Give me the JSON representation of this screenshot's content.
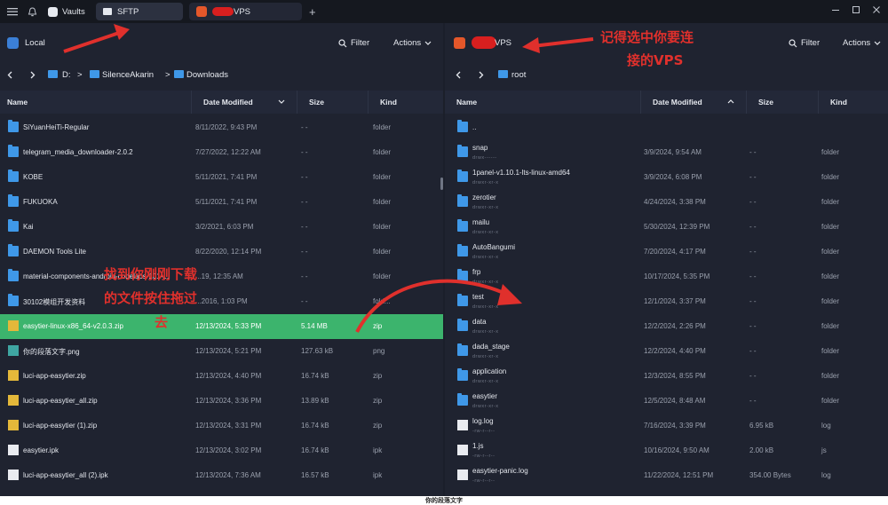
{
  "titlebar": {
    "vaults": "Vaults",
    "sftp_tab": "SFTP",
    "vps_tab": "VPS",
    "add": "+"
  },
  "left": {
    "title": "Local",
    "filter": "Filter",
    "actions": "Actions",
    "crumbs": [
      "D:",
      "SilenceAkarin",
      "Downloads"
    ],
    "cols": {
      "name": "Name",
      "date": "Date Modified",
      "size": "Size",
      "kind": "Kind"
    },
    "rows": [
      {
        "name": "SiYuanHeiTi-Regular",
        "date": "8/11/2022, 9:43 PM",
        "size": "- -",
        "kind": "folder",
        "icon": "folder"
      },
      {
        "name": "telegram_media_downloader-2.0.2",
        "date": "7/27/2022, 12:22 AM",
        "size": "- -",
        "kind": "folder",
        "icon": "folder"
      },
      {
        "name": "KOBE",
        "date": "5/11/2021, 7:41 PM",
        "size": "- -",
        "kind": "folder",
        "icon": "folder"
      },
      {
        "name": "FUKUOKA",
        "date": "5/11/2021, 7:41 PM",
        "size": "- -",
        "kind": "folder",
        "icon": "folder"
      },
      {
        "name": "Kai",
        "date": "3/2/2021, 6:03 PM",
        "size": "- -",
        "kind": "folder",
        "icon": "folder"
      },
      {
        "name": "DAEMON Tools Lite",
        "date": "8/22/2020, 12:14 PM",
        "size": "- -",
        "kind": "folder",
        "icon": "folder"
      },
      {
        "name": "material-components-android-codelabs-101-...",
        "date": "...19, 12:35 AM",
        "size": "- -",
        "kind": "folder",
        "icon": "folder"
      },
      {
        "name": "30102模组开发资料",
        "date": "...2016, 1:03 PM",
        "size": "- -",
        "kind": "fold...",
        "icon": "folder"
      },
      {
        "name": "easytier-linux-x86_64-v2.0.3.zip",
        "date": "12/13/2024, 5:33 PM",
        "size": "5.14 MB",
        "kind": "zip",
        "icon": "zip",
        "selected": true
      },
      {
        "name": "你的段落文字.png",
        "date": "12/13/2024, 5:21 PM",
        "size": "127.63 kB",
        "kind": "png",
        "icon": "png"
      },
      {
        "name": "luci-app-easytier.zip",
        "date": "12/13/2024, 4:40 PM",
        "size": "16.74 kB",
        "kind": "zip",
        "icon": "zip"
      },
      {
        "name": "luci-app-easytier_all.zip",
        "date": "12/13/2024, 3:36 PM",
        "size": "13.89 kB",
        "kind": "zip",
        "icon": "zip"
      },
      {
        "name": "luci-app-easytier (1).zip",
        "date": "12/13/2024, 3:31 PM",
        "size": "16.74 kB",
        "kind": "zip",
        "icon": "zip"
      },
      {
        "name": "easytier.ipk",
        "date": "12/13/2024, 3:02 PM",
        "size": "16.74 kB",
        "kind": "ipk",
        "icon": "doc"
      },
      {
        "name": "luci-app-easytier_all (2).ipk",
        "date": "12/13/2024, 7:36 AM",
        "size": "16.57 kB",
        "kind": "ipk",
        "icon": "doc"
      }
    ]
  },
  "right": {
    "title": "VPS",
    "filter": "Filter",
    "actions": "Actions",
    "crumbs": [
      "root"
    ],
    "cols": {
      "name": "Name",
      "date": "Date Modified",
      "size": "Size",
      "kind": "Kind"
    },
    "rows": [
      {
        "name": "..",
        "perm": "",
        "date": "",
        "size": "",
        "kind": "",
        "icon": "folder"
      },
      {
        "name": "snap",
        "perm": "drwx------",
        "date": "3/9/2024, 9:54 AM",
        "size": "- -",
        "kind": "folder",
        "icon": "folder"
      },
      {
        "name": "1panel-v1.10.1-lts-linux-amd64",
        "perm": "drwxr-xr-x",
        "date": "3/9/2024, 6:08 PM",
        "size": "- -",
        "kind": "folder",
        "icon": "folder"
      },
      {
        "name": "zerotier",
        "perm": "drwxr-xr-x",
        "date": "4/24/2024, 3:38 PM",
        "size": "- -",
        "kind": "folder",
        "icon": "folder"
      },
      {
        "name": "mailu",
        "perm": "drwxr-xr-x",
        "date": "5/30/2024, 12:39 PM",
        "size": "- -",
        "kind": "folder",
        "icon": "folder"
      },
      {
        "name": "AutoBangumi",
        "perm": "drwxr-xr-x",
        "date": "7/20/2024, 4:17 PM",
        "size": "- -",
        "kind": "folder",
        "icon": "folder"
      },
      {
        "name": "frp",
        "perm": "drwxr-xr-x",
        "date": "10/17/2024, 5:35 PM",
        "size": "- -",
        "kind": "folder",
        "icon": "folder"
      },
      {
        "name": "test",
        "perm": "drwxr-xr-x",
        "date": "12/1/2024, 3:37 PM",
        "size": "- -",
        "kind": "folder",
        "icon": "folder"
      },
      {
        "name": "data",
        "perm": "drwxr-xr-x",
        "date": "12/2/2024, 2:26 PM",
        "size": "- -",
        "kind": "folder",
        "icon": "folder"
      },
      {
        "name": "dada_stage",
        "perm": "drwxr-xr-x",
        "date": "12/2/2024, 4:40 PM",
        "size": "- -",
        "kind": "folder",
        "icon": "folder"
      },
      {
        "name": "application",
        "perm": "drwxr-xr-x",
        "date": "12/3/2024, 8:55 PM",
        "size": "- -",
        "kind": "folder",
        "icon": "folder"
      },
      {
        "name": "easytier",
        "perm": "drwxr-xr-x",
        "date": "12/5/2024, 8:48 AM",
        "size": "- -",
        "kind": "folder",
        "icon": "folder"
      },
      {
        "name": "log.log",
        "perm": "-rw-r--r--",
        "date": "7/16/2024, 3:39 PM",
        "size": "6.95 kB",
        "kind": "log",
        "icon": "doc"
      },
      {
        "name": "1.js",
        "perm": "-rw-r--r--",
        "date": "10/16/2024, 9:50 AM",
        "size": "2.00 kB",
        "kind": "js",
        "icon": "doc"
      },
      {
        "name": "easytier-panic.log",
        "perm": "-rw-r--r--",
        "date": "11/22/2024, 12:51 PM",
        "size": "354.00 Bytes",
        "kind": "log",
        "icon": "doc"
      }
    ]
  },
  "annotations": {
    "select_vps_1": "记得选中你要连",
    "select_vps_2": "接的VPS",
    "drag_1": "找到你刚刚下载",
    "drag_2": "的文件按住拖过",
    "drag_3": "去"
  },
  "caption": "你的段落文字",
  "colors": {
    "selected": "#3cb46d",
    "folder": "#3f98e8",
    "annotation": "#e0302c"
  }
}
